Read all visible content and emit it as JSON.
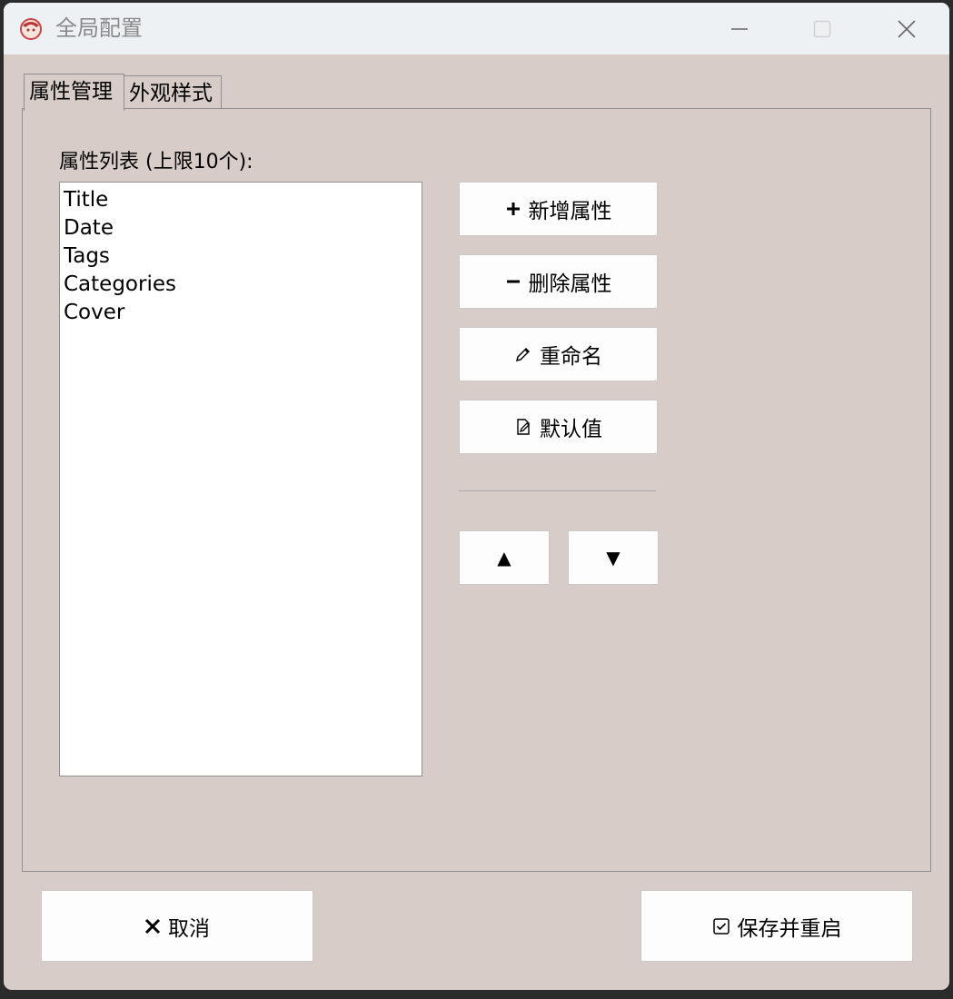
{
  "window": {
    "title": "全局配置",
    "icons": {
      "app": "anime-avatar-icon",
      "minimize": "minimize-icon",
      "maximize": "maximize-icon",
      "close": "close-icon"
    }
  },
  "tabs": [
    {
      "label": "属性管理",
      "active": true
    },
    {
      "label": "外观样式",
      "active": false
    }
  ],
  "attributes": {
    "list_label": "属性列表 (上限10个):",
    "items": [
      "Title",
      "Date",
      "Tags",
      "Categories",
      "Cover"
    ]
  },
  "buttons": {
    "add": {
      "label": "新增属性",
      "icon": "plus-icon"
    },
    "delete": {
      "label": "删除属性",
      "icon": "minus-icon"
    },
    "rename": {
      "label": "重命名",
      "icon": "pencil-icon"
    },
    "default_value": {
      "label": "默认值",
      "icon": "edit-document-icon"
    },
    "move_up": {
      "label": "▲",
      "icon": "up-triangle-icon"
    },
    "move_down": {
      "label": "▼",
      "icon": "down-triangle-icon"
    }
  },
  "footer": {
    "cancel": {
      "label": "取消",
      "icon": "x-icon"
    },
    "save": {
      "label": "保存并重启",
      "icon": "checkbox-icon"
    }
  },
  "colors": {
    "background": "#d7ccc8",
    "titlebar": "#eef1f4",
    "button": "#fdfdfd"
  }
}
